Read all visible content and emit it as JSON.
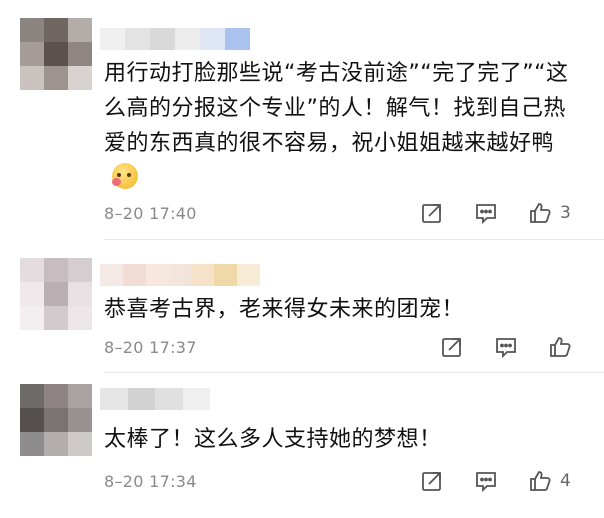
{
  "comments": [
    {
      "text": "用行动打脸那些说“考古没前途”“完了完了”“这么高的分报这个专业”的人！解气！找到自己热爱的东西真的很不容易，祝小姐姐越来越好鸭",
      "emoji": "smiling-blush-emoji",
      "time": "8–20 17:40",
      "likes": "3"
    },
    {
      "text": "恭喜考古界，老来得女未来的团宠！",
      "time": "8–20 17:37",
      "likes": ""
    },
    {
      "text": "太棒了！这么多人支持她的梦想！",
      "time": "8–20 17:34",
      "likes": "4"
    }
  ],
  "icons": {
    "share": "share-icon",
    "reply": "comment-icon",
    "like": "thumbs-up-icon"
  },
  "colors": {
    "text": "#111111",
    "meta": "#8a8a8a",
    "icon": "#555555",
    "divider": "#e8e8e8"
  }
}
